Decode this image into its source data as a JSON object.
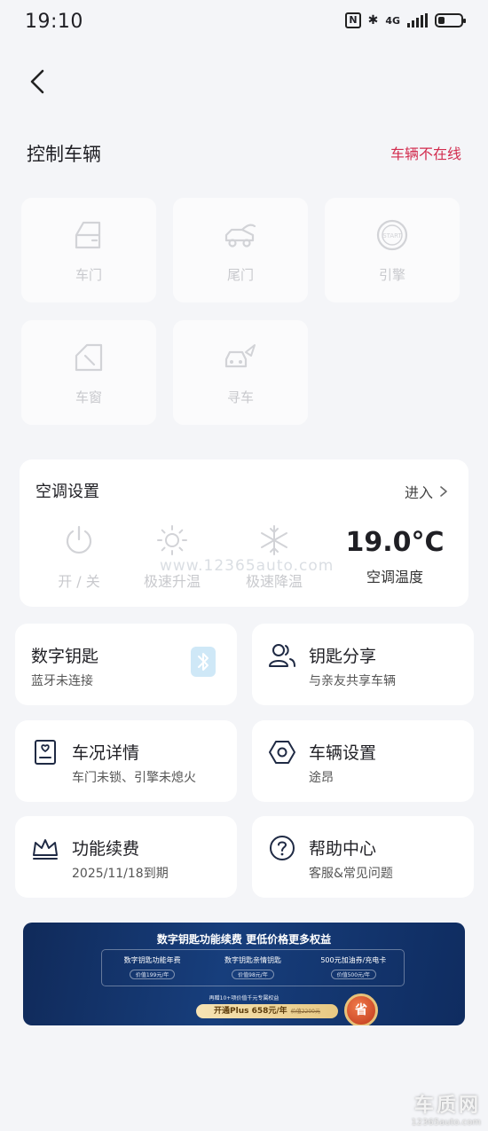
{
  "status_bar": {
    "time": "19:10",
    "nfc": "N",
    "bluetooth": "✱",
    "network": "4G",
    "battery_level": 0.3
  },
  "header": {
    "title": "控制车辆",
    "status": "车辆不在线",
    "status_color": "#d22c4e"
  },
  "controls": [
    {
      "label": "车门",
      "icon": "car-door-icon"
    },
    {
      "label": "尾门",
      "icon": "tailgate-icon"
    },
    {
      "label": "引擎",
      "icon": "engine-start-icon"
    },
    {
      "label": "车窗",
      "icon": "car-window-icon"
    },
    {
      "label": "寻车",
      "icon": "find-car-icon"
    }
  ],
  "engine_icon_text": "START",
  "ac": {
    "title": "空调设置",
    "enter_label": "进入",
    "power_label": "开 / 关",
    "heat_label": "极速升温",
    "cool_label": "极速降温",
    "temperature": "19.0°C",
    "temperature_label": "空调温度"
  },
  "tiles": {
    "digital_key": {
      "title": "数字钥匙",
      "subtitle": "蓝牙未连接"
    },
    "key_share": {
      "title": "钥匙分享",
      "subtitle": "与亲友共享车辆"
    },
    "car_status": {
      "title": "车况详情",
      "subtitle": "车门未锁、引擎未熄火"
    },
    "car_settings": {
      "title": "车辆设置",
      "subtitle": "途昂"
    },
    "renewal": {
      "title": "功能续费",
      "subtitle": "2025/11/18到期"
    },
    "help": {
      "title": "帮助中心",
      "subtitle": "客服&常见问题"
    }
  },
  "banner": {
    "title": "数字钥匙功能续费 更低价格更多权益",
    "items": [
      {
        "name": "数字钥匙功能年费",
        "price": "价值199元/年"
      },
      {
        "name": "数字钥匙亲情钥匙",
        "price": "价值98元/年"
      },
      {
        "name": "500元加油券/充电卡",
        "price": "价值500元/年"
      }
    ],
    "note": "再赠10+项价值千元专属权益",
    "button": "开通Plus 658元/年",
    "button_strike": "价值2200元",
    "seal": "省"
  },
  "watermark": "www.12365auto.com",
  "corner_logo": {
    "name": "车质网",
    "url": "12365auto.com"
  }
}
